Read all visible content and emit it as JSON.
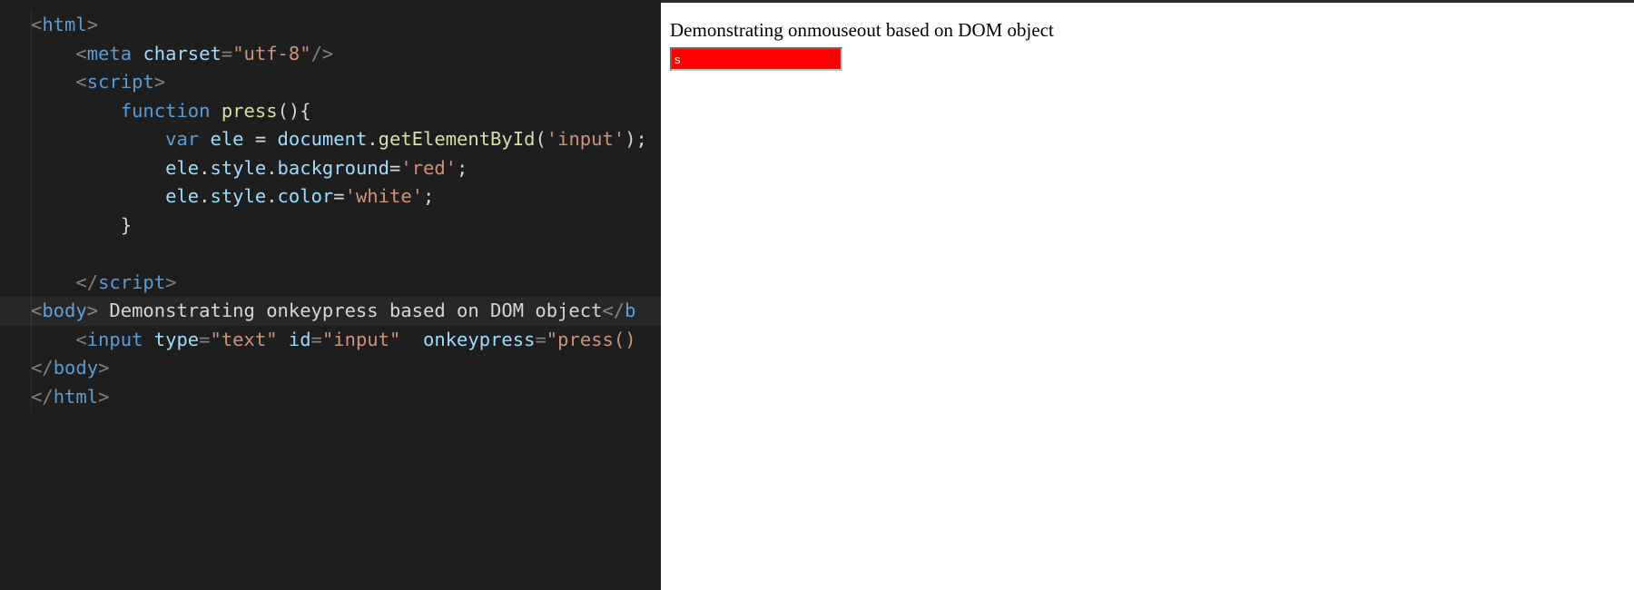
{
  "editor": {
    "code_tokens": [
      [
        [
          "gut",
          ""
        ],
        [
          "punct",
          "<"
        ],
        [
          "tag",
          "html"
        ],
        [
          "punct",
          ">"
        ]
      ],
      [
        [
          "gut",
          ""
        ],
        [
          "in",
          "    "
        ],
        [
          "punct",
          "<"
        ],
        [
          "tag",
          "meta"
        ],
        [
          "txt",
          " "
        ],
        [
          "attr",
          "charset"
        ],
        [
          "punct",
          "="
        ],
        [
          "str",
          "\"utf-8\""
        ],
        [
          "punct",
          "/>"
        ]
      ],
      [
        [
          "gut",
          ""
        ],
        [
          "in",
          "    "
        ],
        [
          "punct",
          "<"
        ],
        [
          "tag",
          "script"
        ],
        [
          "punct",
          ">"
        ]
      ],
      [
        [
          "gut",
          ""
        ],
        [
          "in",
          "        "
        ],
        [
          "kw",
          "function"
        ],
        [
          "txt",
          " "
        ],
        [
          "fn",
          "press"
        ],
        [
          "txt",
          "(){"
        ]
      ],
      [
        [
          "gut",
          ""
        ],
        [
          "in",
          "            "
        ],
        [
          "kw",
          "var"
        ],
        [
          "txt",
          " "
        ],
        [
          "id",
          "ele"
        ],
        [
          "txt",
          " = "
        ],
        [
          "id",
          "document"
        ],
        [
          "txt",
          "."
        ],
        [
          "fn",
          "getElementById"
        ],
        [
          "txt",
          "("
        ],
        [
          "str",
          "'input'"
        ],
        [
          "txt",
          ");"
        ]
      ],
      [
        [
          "gut",
          ""
        ],
        [
          "in",
          "            "
        ],
        [
          "id",
          "ele"
        ],
        [
          "txt",
          "."
        ],
        [
          "id",
          "style"
        ],
        [
          "txt",
          "."
        ],
        [
          "id",
          "background"
        ],
        [
          "txt",
          "="
        ],
        [
          "str",
          "'red'"
        ],
        [
          "txt",
          ";"
        ]
      ],
      [
        [
          "gut",
          ""
        ],
        [
          "in",
          "            "
        ],
        [
          "id",
          "ele"
        ],
        [
          "txt",
          "."
        ],
        [
          "id",
          "style"
        ],
        [
          "txt",
          "."
        ],
        [
          "id",
          "color"
        ],
        [
          "txt",
          "="
        ],
        [
          "str",
          "'white'"
        ],
        [
          "txt",
          ";"
        ]
      ],
      [
        [
          "gut",
          ""
        ],
        [
          "in",
          "        "
        ],
        [
          "txt",
          "}"
        ]
      ],
      [
        [
          "gut",
          ""
        ],
        [
          "txt",
          " "
        ]
      ],
      [
        [
          "gut",
          ""
        ],
        [
          "in",
          "    "
        ],
        [
          "punct",
          "</"
        ],
        [
          "tag",
          "script"
        ],
        [
          "punct",
          ">"
        ]
      ],
      [
        [
          "gut",
          ""
        ],
        [
          "punct",
          "<"
        ],
        [
          "tag",
          "body"
        ],
        [
          "punct",
          ">"
        ],
        [
          "txt",
          " Demonstrating onkeypress based on DOM object"
        ],
        [
          "punct",
          "</"
        ],
        [
          "tag",
          "b"
        ]
      ],
      [
        [
          "gut",
          ""
        ],
        [
          "in",
          "    "
        ],
        [
          "punct",
          "<"
        ],
        [
          "tag",
          "input"
        ],
        [
          "txt",
          " "
        ],
        [
          "attr",
          "type"
        ],
        [
          "punct",
          "="
        ],
        [
          "str",
          "\"text\""
        ],
        [
          "txt",
          " "
        ],
        [
          "attr",
          "id"
        ],
        [
          "punct",
          "="
        ],
        [
          "str",
          "\"input\""
        ],
        [
          "txt",
          "  "
        ],
        [
          "attr",
          "onkeypress"
        ],
        [
          "punct",
          "="
        ],
        [
          "str",
          "\"press()"
        ]
      ],
      [
        [
          "gut",
          ""
        ],
        [
          "punct",
          "</"
        ],
        [
          "tag",
          "body"
        ],
        [
          "punct",
          ">"
        ]
      ],
      [
        [
          "gut",
          ""
        ],
        [
          "punct",
          "</"
        ],
        [
          "tag",
          "html"
        ],
        [
          "punct",
          ">"
        ]
      ]
    ],
    "highlighted_line_index": 10
  },
  "preview": {
    "body_text": "Demonstrating onmouseout based on DOM object",
    "input_value": "s",
    "input_bg": "#ff0000",
    "input_color": "#ffffff"
  }
}
